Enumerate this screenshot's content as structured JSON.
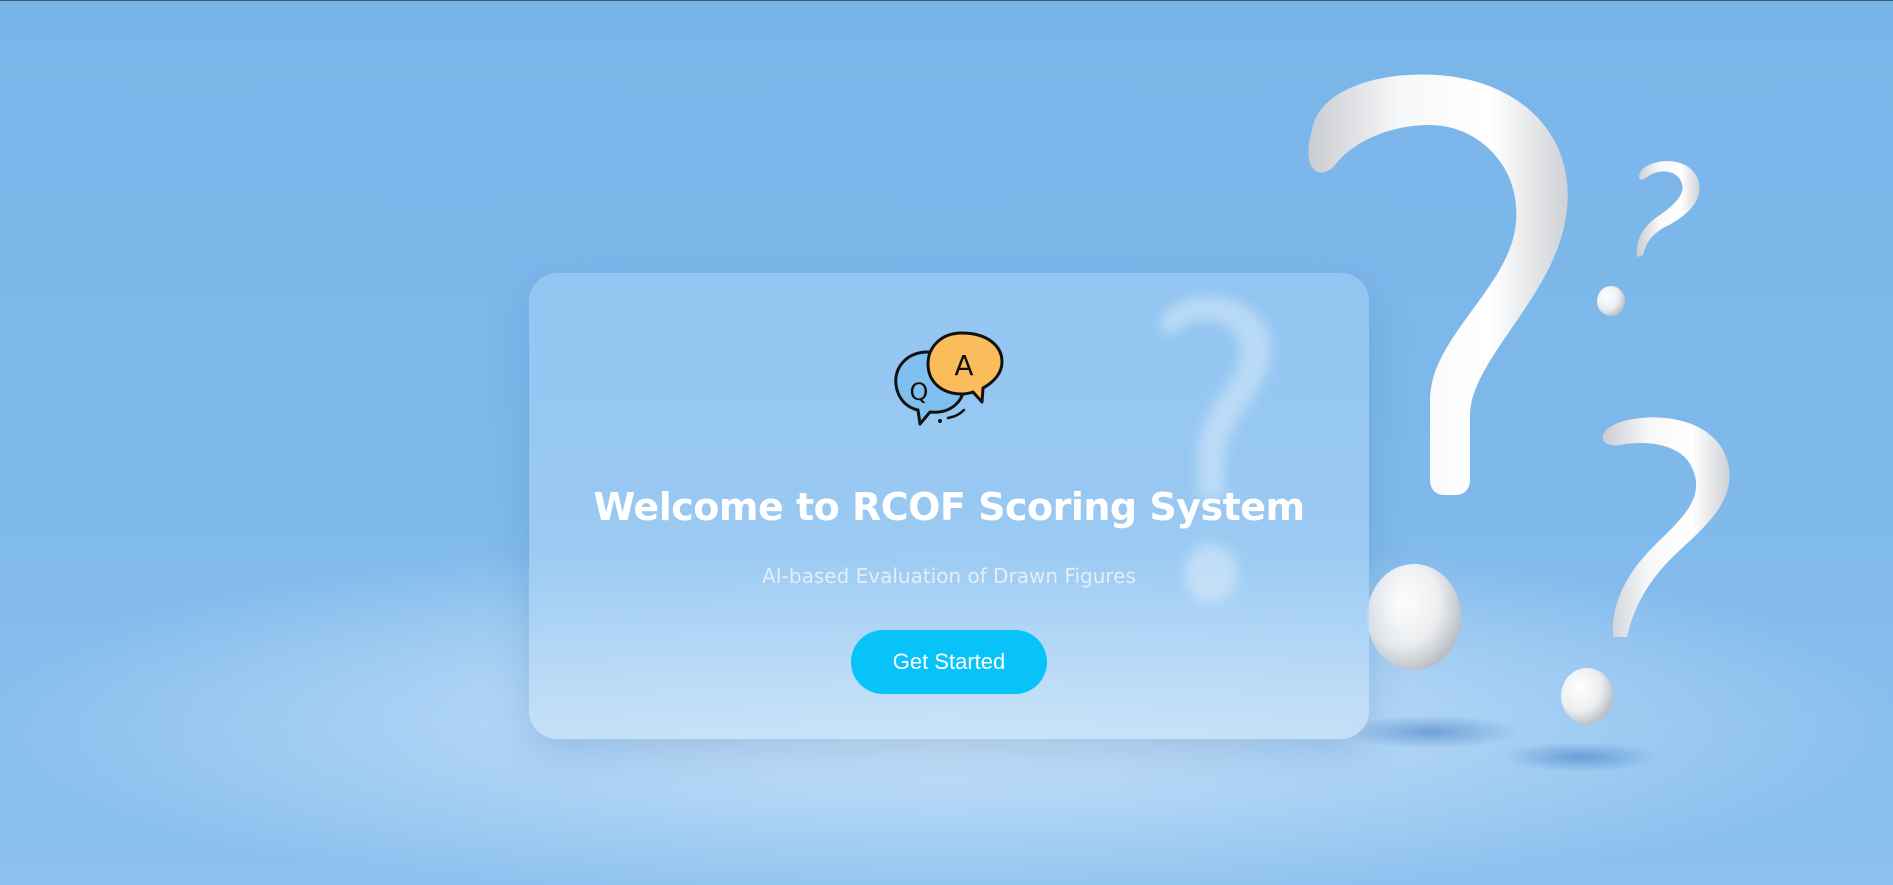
{
  "hero": {
    "title": "Welcome to RCOF Scoring System",
    "subtitle": "AI-based Evaluation of Drawn Figures",
    "cta_label": "Get Started"
  },
  "logo": {
    "icon": "qa-chat-bubbles-icon",
    "question_letter": "Q",
    "answer_letter": "A",
    "question_color": "#7fc0f0",
    "answer_color": "#fbbd5c"
  },
  "colors": {
    "background": "#7fb8ea",
    "button": "#08c3fa",
    "title": "#ffffff"
  }
}
